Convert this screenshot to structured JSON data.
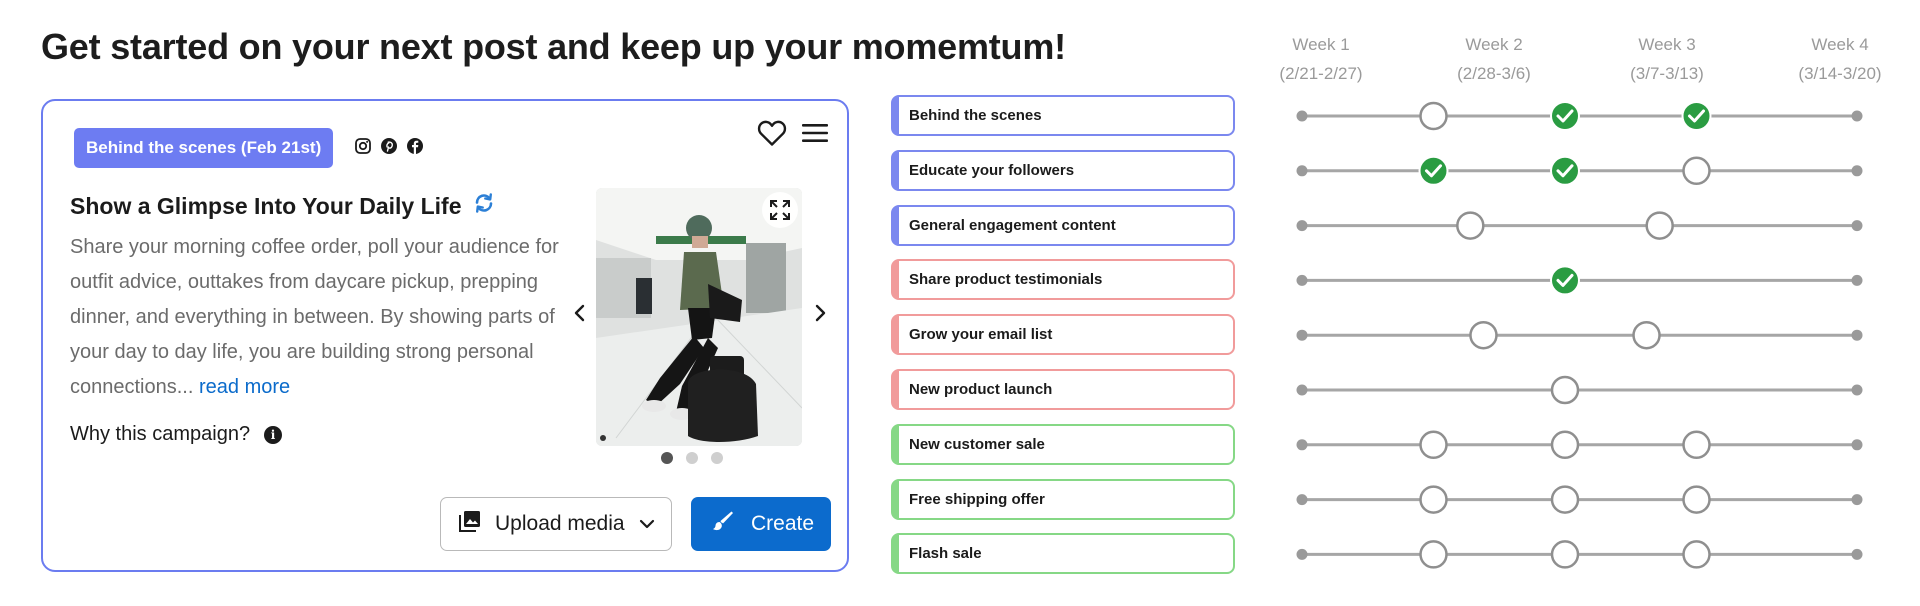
{
  "page": {
    "title": "Get started on your next post and keep up your momemtum!"
  },
  "card": {
    "tag_label": "Behind the scenes (Feb 21st)",
    "social_icons": [
      "instagram-icon",
      "pinterest-icon",
      "facebook-icon"
    ],
    "post_title": "Show a Glimpse Into Your Daily Life",
    "post_body": "Share your morning coffee order, poll your audience for outfit advice, outtakes from daycare pickup, prepping dinner, and everything in between. By showing parts of your day to day life, you are building strong personal connections...",
    "read_more": "read more",
    "why_label": "Why this campaign?",
    "info_glyph": "i",
    "upload_label": "Upload media",
    "create_label": "Create",
    "carousel": {
      "total": 3,
      "active": 1
    }
  },
  "timeline": {
    "weeks": [
      {
        "label": "Week 1",
        "range": "(2/21-2/27)"
      },
      {
        "label": "Week 2",
        "range": "(2/28-3/6)"
      },
      {
        "label": "Week 3",
        "range": "(3/7-3/13)"
      },
      {
        "label": "Week 4",
        "range": "(3/14-3/20)"
      }
    ],
    "colors": {
      "blue": "#7b88ef",
      "red": "#f19b9b",
      "green": "#86d886",
      "check": "#2a9c42",
      "line": "#a6a6a6"
    },
    "campaigns": [
      {
        "label": "Behind the scenes",
        "color": "blue",
        "markers": [
          {
            "pos": 1.0,
            "done": false
          },
          {
            "pos": 2.0,
            "done": true
          },
          {
            "pos": 3.0,
            "done": true
          }
        ]
      },
      {
        "label": "Educate your followers",
        "color": "blue",
        "markers": [
          {
            "pos": 1.0,
            "done": true
          },
          {
            "pos": 2.0,
            "done": true
          },
          {
            "pos": 3.0,
            "done": false
          }
        ]
      },
      {
        "label": "General engagement content",
        "color": "blue",
        "markers": [
          {
            "pos": 1.28,
            "done": false
          },
          {
            "pos": 2.72,
            "done": false
          }
        ]
      },
      {
        "label": "Share product testimonials",
        "color": "red",
        "markers": [
          {
            "pos": 2.0,
            "done": true
          }
        ]
      },
      {
        "label": "Grow your email list",
        "color": "red",
        "markers": [
          {
            "pos": 1.38,
            "done": false
          },
          {
            "pos": 2.62,
            "done": false
          }
        ]
      },
      {
        "label": "New product launch",
        "color": "red",
        "markers": [
          {
            "pos": 2.0,
            "done": false
          }
        ]
      },
      {
        "label": "New customer sale",
        "color": "green",
        "markers": [
          {
            "pos": 1.0,
            "done": false
          },
          {
            "pos": 2.0,
            "done": false
          },
          {
            "pos": 3.0,
            "done": false
          }
        ]
      },
      {
        "label": "Free shipping offer",
        "color": "green",
        "markers": [
          {
            "pos": 1.0,
            "done": false
          },
          {
            "pos": 2.0,
            "done": false
          },
          {
            "pos": 3.0,
            "done": false
          }
        ]
      },
      {
        "label": "Flash sale",
        "color": "green",
        "markers": [
          {
            "pos": 1.0,
            "done": false
          },
          {
            "pos": 2.0,
            "done": false
          },
          {
            "pos": 3.0,
            "done": false
          }
        ]
      }
    ]
  }
}
